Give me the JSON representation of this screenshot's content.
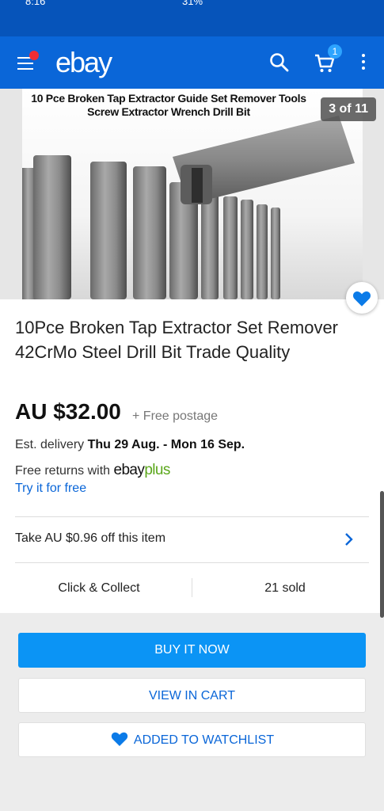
{
  "status_bar": {
    "time": "8:16",
    "battery": "31%"
  },
  "app_bar": {
    "logo": "ebay",
    "cart_count": "1"
  },
  "gallery": {
    "caption_line1": "10 Pce Broken Tap Extractor Guide Set Remover Tools",
    "caption_line2": "Screw Extractor Wrench Drill Bit",
    "counter": "3 of 11"
  },
  "listing": {
    "title": "10Pce Broken Tap Extractor Set Remover 42CrMo Steel Drill Bit Trade Quality",
    "price": "AU $32.00",
    "postage": "+ Free postage",
    "delivery_label": "Est. delivery",
    "delivery_dates": "Thu 29 Aug. - Mon 16 Sep.",
    "returns_label": "Free returns with",
    "ebayplus_ebay": "ebay",
    "ebayplus_plus": "plus",
    "try_free": "Try it for free",
    "offer": "Take AU $0.96 off this item",
    "click_collect": "Click & Collect",
    "sold": "21 sold"
  },
  "actions": {
    "buy_now": "BUY IT NOW",
    "view_in_cart": "VIEW IN CART",
    "added_to_watchlist": "ADDED TO WATCHLIST"
  },
  "colors": {
    "brand_blue": "#0a66d8",
    "buy_button": "#0b94f5",
    "plus_green": "#5ba71b",
    "badge_red": "#f02d34"
  },
  "icons": [
    "menu-icon",
    "search-icon",
    "cart-icon",
    "more-vert-icon",
    "heart-icon",
    "chevron-right-icon"
  ]
}
